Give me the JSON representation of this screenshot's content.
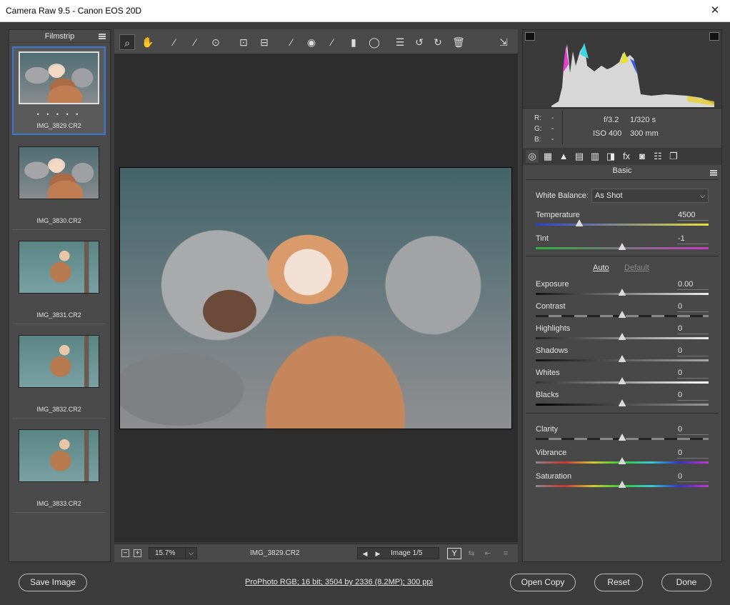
{
  "window": {
    "title": "Camera Raw 9.5  -  Canon EOS 20D",
    "close_glyph": "✕"
  },
  "filmstrip": {
    "header": "Filmstrip",
    "rating_dots": "• • • • •",
    "items": [
      {
        "name": "IMG_3829.CR2"
      },
      {
        "name": "IMG_3830.CR2"
      },
      {
        "name": "IMG_3831.CR2"
      },
      {
        "name": "IMG_3832.CR2"
      },
      {
        "name": "IMG_3833.CR2"
      }
    ]
  },
  "toolbar": {
    "tools": [
      "zoom-icon",
      "hand-icon",
      "white-balance-icon",
      "color-sampler-icon",
      "target-adjustment-icon",
      "crop-icon",
      "straighten-icon",
      "spot-removal-icon",
      "red-eye-icon",
      "adjustment-brush-icon",
      "graduated-filter-icon",
      "radial-filter-icon",
      "presets-list-icon",
      "rotate-left-icon",
      "rotate-right-icon",
      "trash-icon"
    ],
    "glyphs": [
      "⌕",
      "✋",
      "⁄",
      "⁄",
      "⊙",
      "⊡",
      "⊟",
      "⁄",
      "◉",
      "⁄",
      "▮",
      "◯",
      "☰",
      "↺",
      "↻",
      "🗑"
    ],
    "fullscreen_icon": "fullscreen-icon",
    "fullscreen_glyph": "⇲"
  },
  "canvas_bar": {
    "zoom_out": "−",
    "zoom_in": "+",
    "zoom_value": "15.7%",
    "zoom_dd": "⌵",
    "filename": "IMG_3829.CR2",
    "prev": "◀",
    "next": "▶",
    "image_counter": "Image 1/5",
    "y_button": "Y",
    "compare_glyph": "⇆",
    "swap_glyph": "⇤",
    "prefs_glyph": "≡"
  },
  "histogram": {
    "readout": {
      "r_label": "R:",
      "g_label": "G:",
      "b_label": "B:",
      "r": "---",
      "g": "---",
      "b": "---"
    },
    "aperture": "f/3.2",
    "shutter": "1/320 s",
    "iso": "ISO 400",
    "focal": "300 mm"
  },
  "panel_tabs": [
    "basic-icon",
    "tone-curve-icon",
    "detail-icon",
    "hsl-icon",
    "split-toning-icon",
    "lens-corrections-icon",
    "effects-icon",
    "camera-calibration-icon",
    "presets-icon",
    "snapshots-icon"
  ],
  "panel_tab_glyphs": [
    "◎",
    "▦",
    "▲",
    "▤",
    "▥",
    "◨",
    "fx",
    "◙",
    "☷",
    "❐"
  ],
  "basic": {
    "title": "Basic",
    "white_balance_label": "White Balance:",
    "white_balance_value": "As Shot",
    "white_balance_dd": "⌵",
    "auto": "Auto",
    "default": "Default",
    "sliders": [
      {
        "label": "Temperature",
        "value": "4500",
        "pos": 0.25
      },
      {
        "label": "Tint",
        "value": "-1",
        "pos": 0.5
      },
      {
        "label": "Exposure",
        "value": "0.00",
        "pos": 0.5
      },
      {
        "label": "Contrast",
        "value": "0",
        "pos": 0.5
      },
      {
        "label": "Highlights",
        "value": "0",
        "pos": 0.5
      },
      {
        "label": "Shadows",
        "value": "0",
        "pos": 0.5
      },
      {
        "label": "Whites",
        "value": "0",
        "pos": 0.5
      },
      {
        "label": "Blacks",
        "value": "0",
        "pos": 0.5
      },
      {
        "label": "Clarity",
        "value": "0",
        "pos": 0.5
      },
      {
        "label": "Vibrance",
        "value": "0",
        "pos": 0.5
      },
      {
        "label": "Saturation",
        "value": "0",
        "pos": 0.5
      }
    ]
  },
  "bottom": {
    "save": "Save Image",
    "info": "ProPhoto RGB; 16 bit; 3504 by 2336 (8.2MP); 300 ppi",
    "open_copy": "Open Copy",
    "reset": "Reset",
    "done": "Done"
  }
}
